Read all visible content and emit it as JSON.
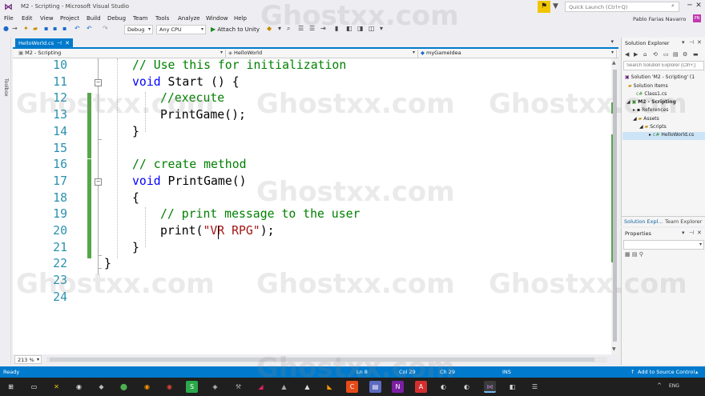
{
  "window": {
    "title": "M2 - Scripting - Microsoft Visual Studio",
    "quick_launch_placeholder": "Quick Launch (Ctrl+Q)",
    "user_name": "Pablo Farias Navarro",
    "avatar_initials": "PN",
    "minimize": "─",
    "maximize": "☐",
    "close": "✕",
    "logo_glyph": "⋈",
    "flag_glyph": "⚑",
    "filter_glyph": "▼"
  },
  "menu": [
    "File",
    "Edit",
    "View",
    "Project",
    "Build",
    "Debug",
    "Team",
    "Tools",
    "Analyze",
    "Window",
    "Help"
  ],
  "toolbar": {
    "configuration": "Debug",
    "platform": "Any CPU",
    "attach_label": "Attach to Unity",
    "attach_glyph": "▶"
  },
  "toolbox": {
    "label": "Toolbox"
  },
  "document_tab": {
    "label": "HelloWorld.cs",
    "pin_glyph": "⊣",
    "close_glyph": "✕"
  },
  "navbar": {
    "project": "M2 - Scripting",
    "class": "HelloWorld",
    "member": "myGameIdea"
  },
  "editor": {
    "lines": [
      {
        "num": "10",
        "tokens": [
          {
            "t": "// Use this for initialization",
            "c": "cm"
          }
        ]
      },
      {
        "num": "11",
        "tokens": [
          {
            "t": "void",
            "c": "kw"
          },
          {
            "t": " Start () {",
            "c": ""
          }
        ]
      },
      {
        "num": "12",
        "tokens": [
          {
            "t": "//execute",
            "c": "cm"
          }
        ]
      },
      {
        "num": "13",
        "tokens": [
          {
            "t": "PrintGame();",
            "c": ""
          }
        ]
      },
      {
        "num": "14",
        "tokens": [
          {
            "t": "}",
            "c": ""
          }
        ]
      },
      {
        "num": "15",
        "tokens": []
      },
      {
        "num": "16",
        "tokens": [
          {
            "t": "// create method",
            "c": "cm"
          }
        ]
      },
      {
        "num": "17",
        "tokens": [
          {
            "t": "void",
            "c": "kw"
          },
          {
            "t": " PrintGame()",
            "c": ""
          }
        ]
      },
      {
        "num": "18",
        "tokens": [
          {
            "t": "{",
            "c": ""
          }
        ]
      },
      {
        "num": "19",
        "tokens": [
          {
            "t": "// print message to the user",
            "c": "cm"
          }
        ]
      },
      {
        "num": "20",
        "tokens": [
          {
            "t": "print(",
            "c": ""
          },
          {
            "t": "\"VR RPG\"",
            "c": "st"
          },
          {
            "t": ");",
            "c": ""
          }
        ]
      },
      {
        "num": "21",
        "tokens": [
          {
            "t": "}",
            "c": ""
          }
        ]
      },
      {
        "num": "22",
        "tokens": [
          {
            "t": "}",
            "c": ""
          }
        ]
      },
      {
        "num": "23",
        "tokens": []
      },
      {
        "num": "24",
        "tokens": []
      }
    ],
    "collapse_glyph": "−",
    "zoom": "213 %"
  },
  "solution_explorer": {
    "title": "Solution Explorer",
    "search_placeholder": "Search Solution Explorer (Ctrl+;)",
    "tree": [
      "Solution 'M2 - Scripting' (1",
      "Solution Items",
      "Class1.cs",
      "M2 - Scripting",
      "References",
      "Assets",
      "Scripts",
      "HelloWorld.cs"
    ],
    "tab_solution": "Solution Expl...",
    "tab_team": "Team Explorer",
    "dropdown_glyph": "▾",
    "pin_glyph": "⊣",
    "close_glyph": "✕"
  },
  "properties": {
    "title": "Properties"
  },
  "statusbar": {
    "ready": "Ready",
    "line": "Ln 8",
    "col": "Col 29",
    "ch": "Ch 29",
    "mode": "INS",
    "source_control": "Add to Source Control"
  },
  "taskbar": {
    "tray_language": "ENG",
    "icons": [
      "⊞",
      "🔍",
      "▭",
      "✕",
      "◉",
      "◆",
      "⬤",
      "◉",
      "S",
      "◈",
      "⚒",
      "◢",
      "▲",
      "◣",
      "▲",
      "C",
      "▤",
      "N",
      "A",
      "◐",
      "◐",
      "◍",
      "⋈",
      "◧",
      "☰"
    ]
  },
  "watermark": "Ghostxx.com"
}
